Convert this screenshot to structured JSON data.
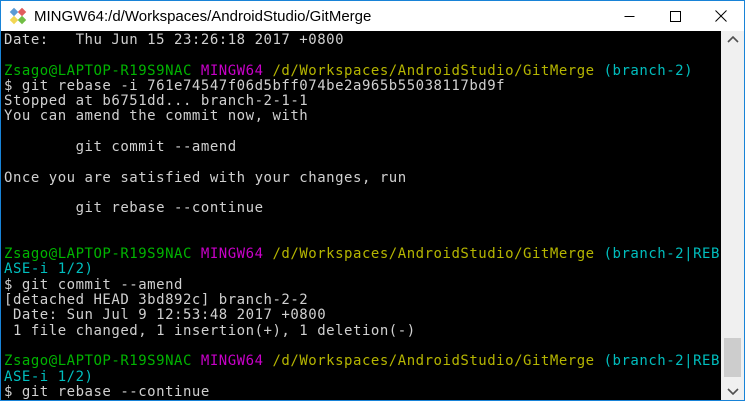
{
  "window": {
    "title": "MINGW64:/d/Workspaces/AndroidStudio/GitMerge",
    "border_color": "#1883D7",
    "titlebar_background": "#FFFFFF",
    "icons": {
      "app": "msys-diamonds",
      "minimize": "—",
      "maximize": "▢",
      "close": "✕",
      "scroll_up": "⌃",
      "scroll_down": "⌄"
    }
  },
  "terminal": {
    "background": "#000000",
    "palette": {
      "fg": "#D0D0D0",
      "green": "#00B400",
      "magenta": "#C800C8",
      "yellow": "#B5B500",
      "cyan": "#00BEBE"
    },
    "lines": [
      [
        {
          "t": "Date:   Thu Jun 15 23:26:18 2017 +0800",
          "c": "fg"
        }
      ],
      [],
      [
        {
          "t": "Zsago@LAPTOP-R19S9NAC ",
          "c": "green"
        },
        {
          "t": "MINGW64 ",
          "c": "magenta"
        },
        {
          "t": "/d/Workspaces/AndroidStudio/GitMerge ",
          "c": "yellow"
        },
        {
          "t": "(branch-2)",
          "c": "cyan"
        }
      ],
      [
        {
          "t": "$ git rebase -i 761e74547f06d5bff074be2a965b55038117bd9f",
          "c": "fg"
        }
      ],
      [
        {
          "t": "Stopped at b6751dd... branch-2-1-1",
          "c": "fg"
        }
      ],
      [
        {
          "t": "You can amend the commit now, with",
          "c": "fg"
        }
      ],
      [],
      [
        {
          "t": "        git commit --amend",
          "c": "fg"
        }
      ],
      [],
      [
        {
          "t": "Once you are satisfied with your changes, run",
          "c": "fg"
        }
      ],
      [],
      [
        {
          "t": "        git rebase --continue",
          "c": "fg"
        }
      ],
      [],
      [],
      [
        {
          "t": "Zsago@LAPTOP-R19S9NAC ",
          "c": "green"
        },
        {
          "t": "MINGW64 ",
          "c": "magenta"
        },
        {
          "t": "/d/Workspaces/AndroidStudio/GitMerge ",
          "c": "yellow"
        },
        {
          "t": "(branch-2|REB",
          "c": "cyan"
        }
      ],
      [
        {
          "t": "ASE-i 1/2)",
          "c": "cyan"
        }
      ],
      [
        {
          "t": "$ git commit --amend",
          "c": "fg"
        }
      ],
      [
        {
          "t": "[detached HEAD 3bd892c] branch-2-2",
          "c": "fg"
        }
      ],
      [
        {
          "t": " Date: Sun Jul 9 12:53:48 2017 +0800",
          "c": "fg"
        }
      ],
      [
        {
          "t": " 1 file changed, 1 insertion(+), 1 deletion(-)",
          "c": "fg"
        }
      ],
      [],
      [
        {
          "t": "Zsago@LAPTOP-R19S9NAC ",
          "c": "green"
        },
        {
          "t": "MINGW64 ",
          "c": "magenta"
        },
        {
          "t": "/d/Workspaces/AndroidStudio/GitMerge ",
          "c": "yellow"
        },
        {
          "t": "(branch-2|REB",
          "c": "cyan"
        }
      ],
      [
        {
          "t": "ASE-i 1/2)",
          "c": "cyan"
        }
      ],
      [
        {
          "t": "$ git rebase --continue",
          "c": "fg"
        }
      ]
    ]
  }
}
